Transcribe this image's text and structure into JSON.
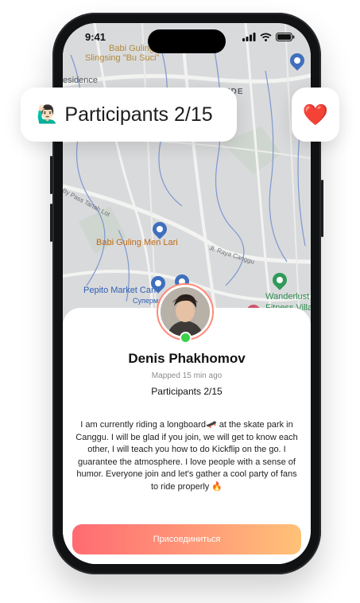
{
  "status_bar": {
    "time": "9:41"
  },
  "map": {
    "labels": {
      "top_poi": "Babi Guling",
      "top_poi_2": "Slingsing \"Bu Suci\"",
      "residence": "esidence",
      "area": "GUNUNG PANDE",
      "road_left": "By Pass Tanah Lot",
      "poi_center": "Babi Guling Men Lari",
      "road_right": "Jl. Raya Canggu",
      "market": "Pepito Market Can",
      "market_ru": "Супермар",
      "wander_1": "Wanderlust",
      "wander_2": "Fitness Villa"
    },
    "colors": {
      "water": "#6f8fcf",
      "road": "#f1f1ef",
      "poi_orange": "#c9752b",
      "poi_blue": "#3f6fbd",
      "poi_green": "#2f9b58"
    }
  },
  "participants_pill": {
    "emoji": "🙋🏻‍♂️",
    "text": "Participants 2/15"
  },
  "heart_pill": {
    "icon": "❤️"
  },
  "profile": {
    "name": "Denis Phakhomov",
    "mapped": "Mapped 15 min ago",
    "participants": "Participants 2/15",
    "description": "I am currently riding a longboard🛹 at the skate park in Canggu. I will be glad if you join, we will get to know each other, I will teach you how to do Kickflip on the go. I guarantee the atmosphere. I love people with a sense of humor. Everyone join and let's gather a cool party of fans to ride properly 🔥",
    "online": true
  },
  "actions": {
    "join_label": "Присоединиться"
  },
  "accent": {
    "gradient_start": "#ff6b72",
    "gradient_end": "#ffc277",
    "online_dot": "#3bd14c"
  }
}
